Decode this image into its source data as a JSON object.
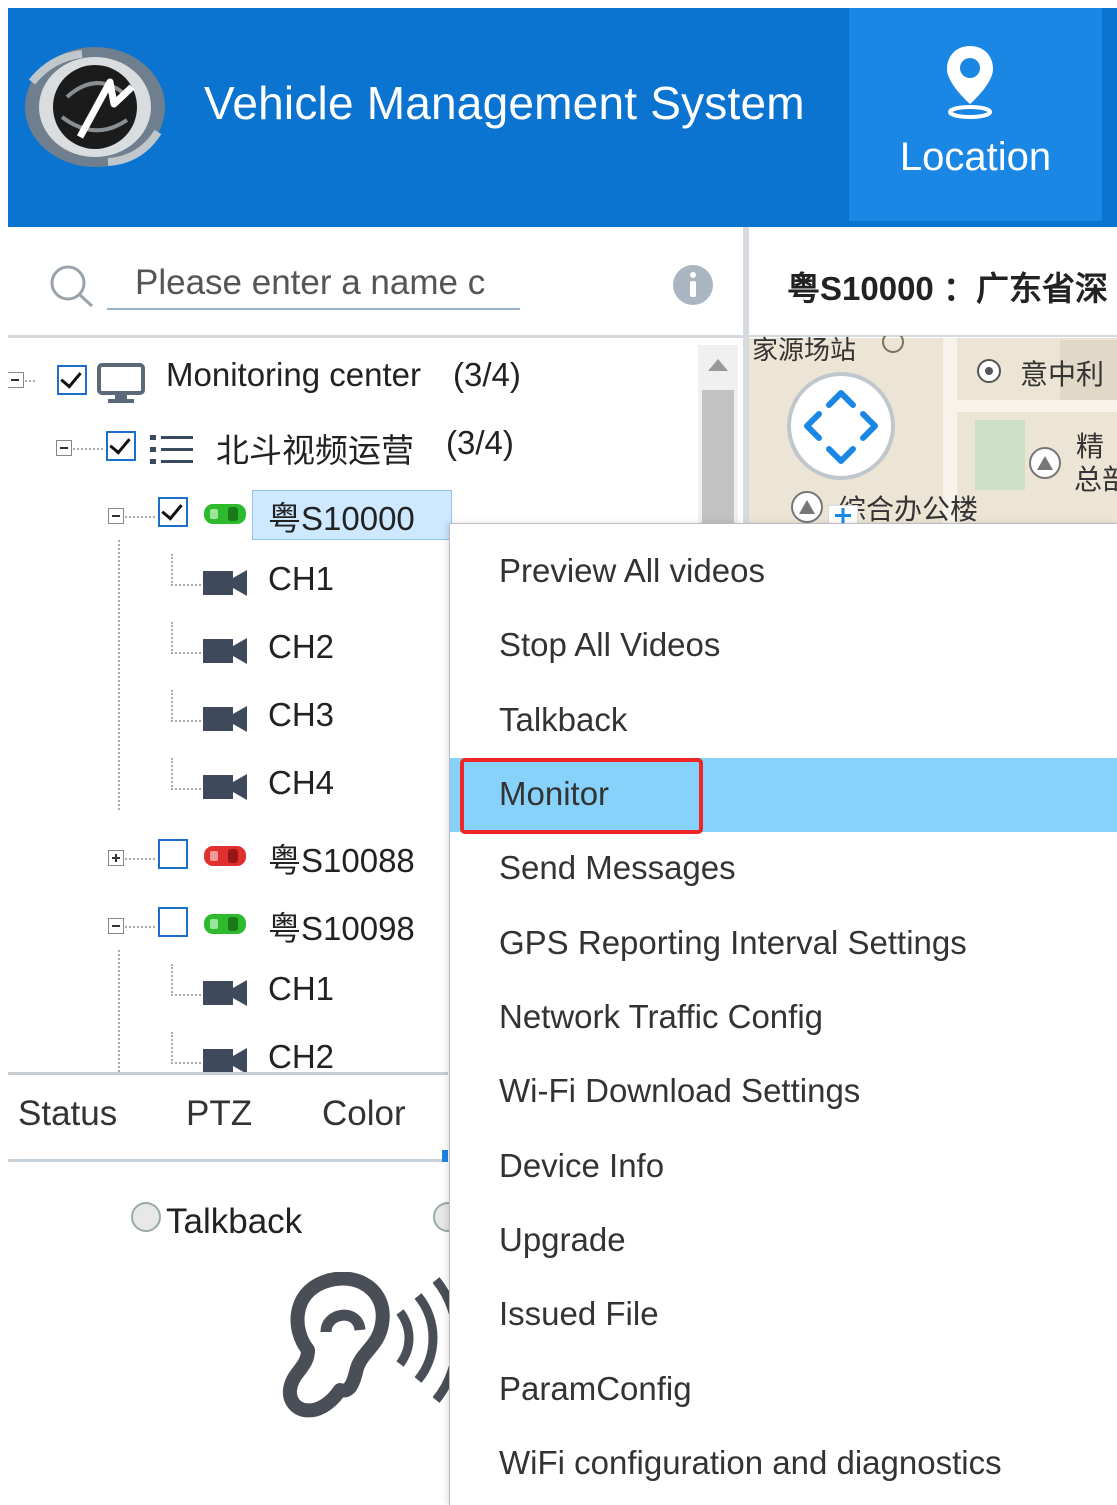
{
  "header": {
    "app_title": "Vehicle Management System",
    "nav_location_label": "Location"
  },
  "search": {
    "placeholder": "Please enter a name c"
  },
  "tree": {
    "root": {
      "label": "Monitoring center",
      "count": "(3/4)"
    },
    "group": {
      "label": "北斗视频运营",
      "count": "(3/4)"
    },
    "vehicles": [
      {
        "plate": "粤S10000",
        "status": "online",
        "checked": true,
        "channels": [
          "CH1",
          "CH2",
          "CH3",
          "CH4"
        ]
      },
      {
        "plate": "粤S10088",
        "status": "offline",
        "checked": false,
        "channels": []
      },
      {
        "plate": "粤S10098",
        "status": "online",
        "checked": false,
        "channels": [
          "CH1",
          "CH2"
        ]
      }
    ]
  },
  "bottom_tabs": [
    "Status",
    "PTZ",
    "Color"
  ],
  "talk_panel": {
    "radio_label": "Talkback"
  },
  "plate_bar": {
    "text": "粤S10000 ：广东省深"
  },
  "map": {
    "labels": [
      "家源场站",
      "意中利",
      "精",
      "总部",
      "综合办公楼"
    ]
  },
  "context_menu": {
    "items": [
      "Preview All videos",
      "Stop All Videos",
      "Talkback",
      "Monitor",
      "Send Messages",
      "GPS Reporting Interval Settings",
      "Network Traffic Config",
      "Wi-Fi Download Settings",
      "Device Info",
      "Upgrade",
      "Issued File",
      "ParamConfig",
      "WiFi configuration and diagnostics"
    ],
    "highlighted_item": "Monitor"
  },
  "colors": {
    "header_bg": "#0a74d0",
    "nav_active_bg": "#1a87e4",
    "menu_highlight": "#86d2fb",
    "annotation_box": "#ee2626",
    "vehicle_online": "#2dbb2d",
    "vehicle_offline": "#e03030"
  }
}
